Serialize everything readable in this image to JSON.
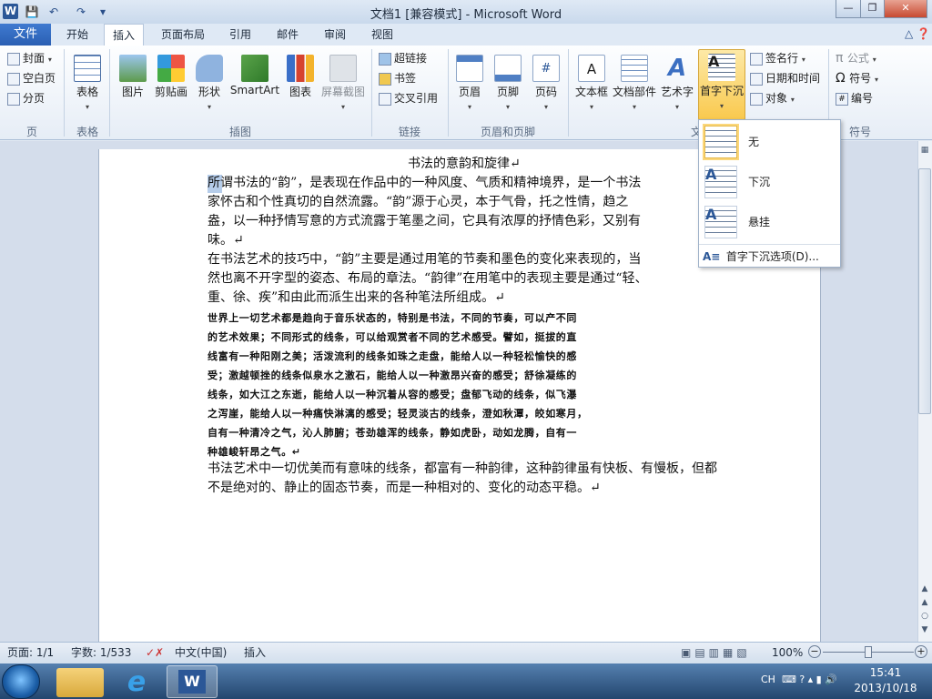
{
  "window": {
    "title": "文档1 [兼容模式] - Microsoft Word",
    "min": "—",
    "max": "❐",
    "close": "✕"
  },
  "qat": {
    "save": "💾",
    "undo": "↶",
    "redo": "↷",
    "more": "▾"
  },
  "tabs": {
    "file": "文件",
    "items": [
      "开始",
      "插入",
      "页面布局",
      "引用",
      "邮件",
      "审阅",
      "视图"
    ],
    "active": "插入"
  },
  "ribbon": {
    "page_group": {
      "label": "页",
      "cover": "封面",
      "blank": "空白页",
      "break": "分页"
    },
    "table_group": {
      "label": "表格",
      "table": "表格"
    },
    "illus_group": {
      "label": "插图",
      "picture": "图片",
      "clipart": "剪贴画",
      "shapes": "形状",
      "smartart": "SmartArt",
      "chart": "图表",
      "screenshot": "屏幕截图"
    },
    "links_group": {
      "label": "链接",
      "hyperlink": "超链接",
      "bookmark": "书签",
      "crossref": "交叉引用"
    },
    "hf_group": {
      "label": "页眉和页脚",
      "header": "页眉",
      "footer": "页脚",
      "pagenum": "页码"
    },
    "text_group": {
      "label": "文",
      "textbox": "文本框",
      "quickparts": "文档部件",
      "wordart": "艺术字",
      "dropcap": "首字下沉",
      "sigline": "签名行",
      "datetime": "日期和时间",
      "object": "对象"
    },
    "symbols_group": {
      "label": "符号",
      "equation": "公式",
      "symbol": "符号",
      "number": "编号"
    }
  },
  "dropdown": {
    "items": [
      "无",
      "下沉",
      "悬挂"
    ],
    "options": "首字下沉选项(D)..."
  },
  "document": {
    "title": "书法的意韵和旋律↵",
    "para1": [
      "所谓书法的“韵”，是表现在作品中的一种风度、气质和精神境界，是一个书法",
      "家怀古和个性真切的自然流露。“韵”源于心灵，本于气骨，托之性情，趋之",
      "盎，以一种抒情写意的方式流露于笔墨之间，它具有浓厚的抒情色彩，又别有",
      "味。↵"
    ],
    "para2": [
      "在书法艺术的技巧中，“韵”主要是通过用笔的节奏和墨色的变化来表现的，当",
      "然也离不开字型的姿态、布局的章法。“韵律”在用笔中的表现主要是通过“轻、",
      "重、徐、疾”和由此而派生出来的各种笔法所组成。↵"
    ],
    "para3": [
      "世界上一切艺术都是趋向于音乐状态的，特别是书法，不同的节奏，可以产不同",
      "的艺术效果；不同形式的线条，可以给观赏者不同的艺术感受。譬如，挺拔的直",
      "线富有一种阳刚之美；活泼流利的线条如珠之走盘，能给人以一种轻松愉快的感",
      "受；激越顿挫的线条似泉水之激石，能给人以一种激昂兴奋的感受；舒徐凝练的",
      "线条，如大江之东逝，能给人以一种沉着从容的感受；盘郁飞动的线条，似飞瀑",
      "之泻崖，能给人以一种痛快淋漓的感受；轻灵淡古的线条，澄如秋潭，皎如寒月，",
      "自有一种清冷之气，沁人肺腑；苍劲雄浑的线条，静如虎卧，动如龙腾，自有一",
      "种雄峻轩昂之气。↵"
    ],
    "para4": [
      "书法艺术中一切优美而有意味的线条，都富有一种韵律，这种韵律虽有快板、有慢板，但都",
      "不是绝对的、静止的固态节奏，而是一种相对的、变化的动态平稳。↵"
    ]
  },
  "status": {
    "page": "页面: 1/1",
    "words": "字数: 1/533",
    "lang": "中文(中国)",
    "mode": "插入",
    "zoom": "100%"
  },
  "taskbar": {
    "lang": "CH",
    "time": "15:41",
    "date": "2013/10/18"
  },
  "colors": {
    "file_tab": "#2a5fb3",
    "dropcap_highlight": "#fbd77b",
    "selection": "#b6cdea"
  }
}
